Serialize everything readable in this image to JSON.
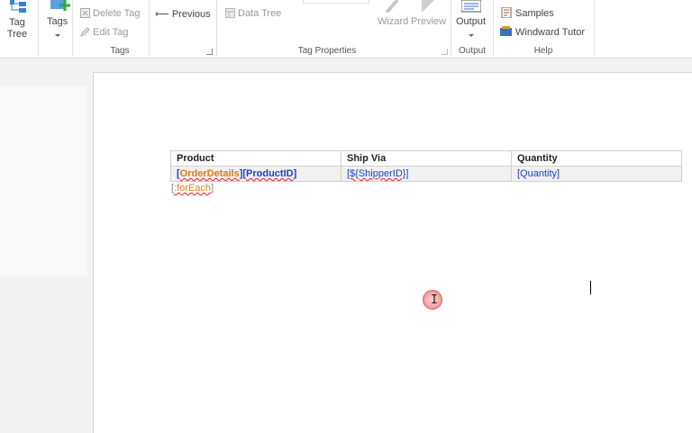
{
  "ribbon": {
    "tag_tree": {
      "line1": "Tag",
      "line2": "Tree"
    },
    "tags_label": "Tags",
    "delete_tag": "Delete Tag",
    "edit_tag": "Edit Tag",
    "previous": "Previous",
    "data_tree": "Data Tree",
    "wizard": "Wizard",
    "preview": "Preview",
    "output": "Output",
    "samples": "Samples",
    "windward_tutor": "Windward Tutor",
    "groups": {
      "tags": "Tags",
      "tag_properties": "Tag Properties",
      "output": "Output",
      "help": "Help"
    }
  },
  "document": {
    "headers": [
      "Product",
      "Ship Via",
      "Quantity"
    ],
    "row": {
      "product_tag1": "OrderDetails",
      "product_tag2": "ProductID",
      "ship_via": "[${ShipperID}]",
      "quantity": "[Quantity]"
    },
    "foreach_tag": ":forEach",
    "bracket_open": "[",
    "bracket_close": "]",
    "bracket_mid": "][",
    "cursor_glyph": "I"
  }
}
